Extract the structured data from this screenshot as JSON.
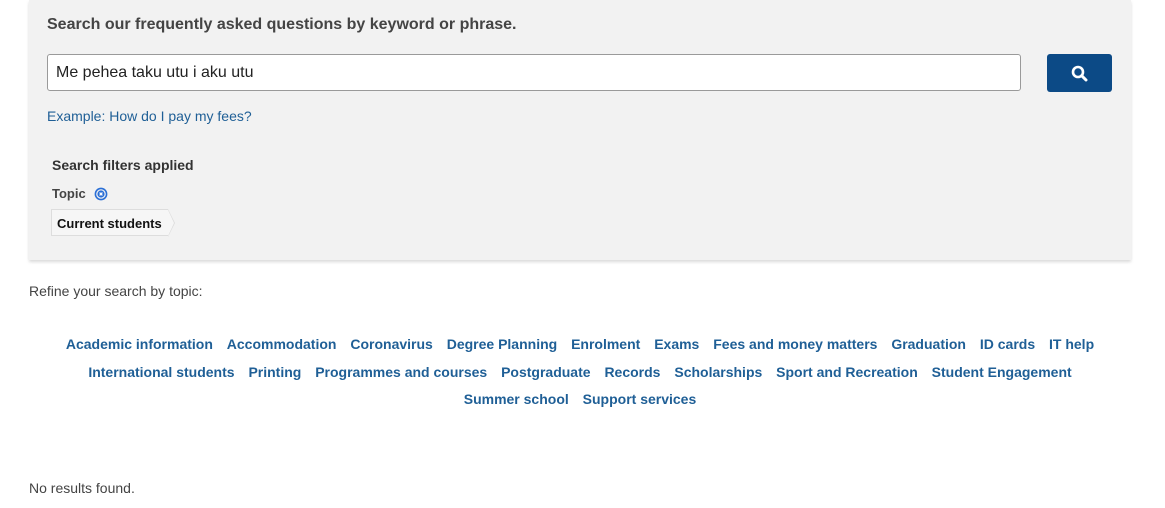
{
  "search": {
    "heading": "Search our frequently asked questions by keyword or phrase.",
    "input_value": "Me pehea taku utu i aku utu",
    "button_icon": "search-icon",
    "example_prefix": "Example:",
    "example_link": "How do I pay my fees?"
  },
  "filters": {
    "heading": "Search filters applied",
    "topic_label": "Topic",
    "remove_icon": "close-circle-icon",
    "applied": "Current students"
  },
  "refine": {
    "label": "Refine your search by topic:",
    "topics": [
      "Academic information",
      "Accommodation",
      "Coronavirus",
      "Degree Planning",
      "Enrolment",
      "Exams",
      "Fees and money matters",
      "Graduation",
      "ID cards",
      "IT help",
      "International students",
      "Printing",
      "Programmes and courses",
      "Postgraduate",
      "Records",
      "Scholarships",
      "Sport and Recreation",
      "Student Engagement",
      "Summer school",
      "Support services"
    ]
  },
  "results": {
    "message": "No results found."
  },
  "colors": {
    "panel_bg": "#f2f2f2",
    "button_bg": "#0c4a86",
    "link": "#1f5f96",
    "remove_icon": "#2a6fd6"
  }
}
